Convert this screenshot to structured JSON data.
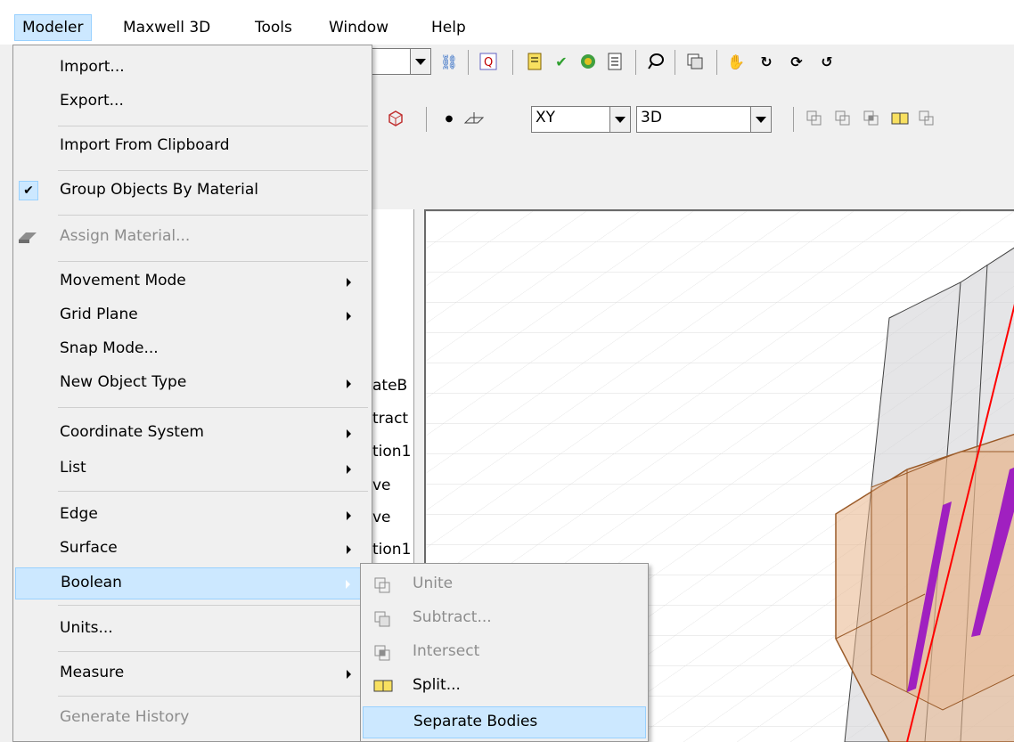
{
  "menubar": {
    "items": [
      {
        "label": "Modeler"
      },
      {
        "label": "Maxwell 3D"
      },
      {
        "label": "Tools"
      },
      {
        "label": "Window"
      },
      {
        "label": "Help"
      }
    ]
  },
  "toolbar2": {
    "plane_combo": "XY",
    "view_combo": "3D"
  },
  "tree_fragments": [
    "ateB",
    "tract",
    "tion1",
    "ve",
    "ve",
    "tion1"
  ],
  "menu": {
    "import": {
      "label": "Import..."
    },
    "export": {
      "label": "Export..."
    },
    "import_clipboard": {
      "label": "Import From Clipboard"
    },
    "group_by_material": {
      "label": "Group Objects By Material",
      "checked": true
    },
    "assign_material": {
      "label": "Assign Material..."
    },
    "movement_mode": {
      "label": "Movement Mode"
    },
    "grid_plane": {
      "label": "Grid Plane"
    },
    "snap_mode": {
      "label": "Snap Mode..."
    },
    "new_object_type": {
      "label": "New Object Type"
    },
    "coordinate_system": {
      "label": "Coordinate System"
    },
    "list": {
      "label": "List"
    },
    "edge": {
      "label": "Edge"
    },
    "surface": {
      "label": "Surface"
    },
    "boolean": {
      "label": "Boolean"
    },
    "units": {
      "label": "Units..."
    },
    "measure": {
      "label": "Measure"
    },
    "generate_history": {
      "label": "Generate History"
    }
  },
  "submenu": {
    "unite": {
      "label": "Unite"
    },
    "subtract": {
      "label": "Subtract..."
    },
    "intersect": {
      "label": "Intersect"
    },
    "split": {
      "label": "Split..."
    },
    "separate_bodies": {
      "label": "Separate Bodies"
    }
  },
  "colors": {
    "highlight": "#cce8ff",
    "highlight_border": "#99d1ff",
    "disabled_text": "#8d8d8d",
    "axis_line": "#ff0000",
    "coil": "#a020c0",
    "core": "#e8b48a"
  }
}
